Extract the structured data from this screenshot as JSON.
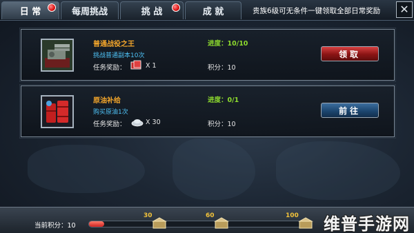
{
  "tabs": [
    {
      "label": "日 常",
      "active": true,
      "badge": true
    },
    {
      "label": "每周挑战",
      "active": false,
      "badge": false
    },
    {
      "label": "挑 战",
      "active": false,
      "badge": true
    },
    {
      "label": "成 就",
      "active": false,
      "badge": false
    }
  ],
  "notice": "贵族6级可无条件一键领取全部日常奖励",
  "close_icon": "close-icon",
  "tasks": [
    {
      "name": "普通战役之王",
      "desc": "挑战普通副本10次",
      "reward_label": "任务奖励：",
      "reward_icon": "ticket-icon",
      "reward_count": "X 1",
      "progress": "进度：10/10",
      "points": "积分：10",
      "button": "领取",
      "button_type": "claim"
    },
    {
      "name": "原油补给",
      "desc": "购买原油1次",
      "reward_label": "任务奖励：",
      "reward_icon": "silver-ingot-icon",
      "reward_count": "X 30",
      "progress": "进度：0/1",
      "points": "积分：10",
      "button": "前往",
      "button_type": "go"
    }
  ],
  "bottom": {
    "points_label": "当前积分：10",
    "progress_fraction": 0.07,
    "milestones": [
      "30",
      "60",
      "100"
    ]
  },
  "watermark": "维普手游网",
  "colors": {
    "task_name": "#f2a52b",
    "task_desc": "#4fc3f7",
    "progress_text": "#8edb2e",
    "claim_button": "#b32020",
    "go_button": "#24507c",
    "milestone": "#f3c33a"
  }
}
